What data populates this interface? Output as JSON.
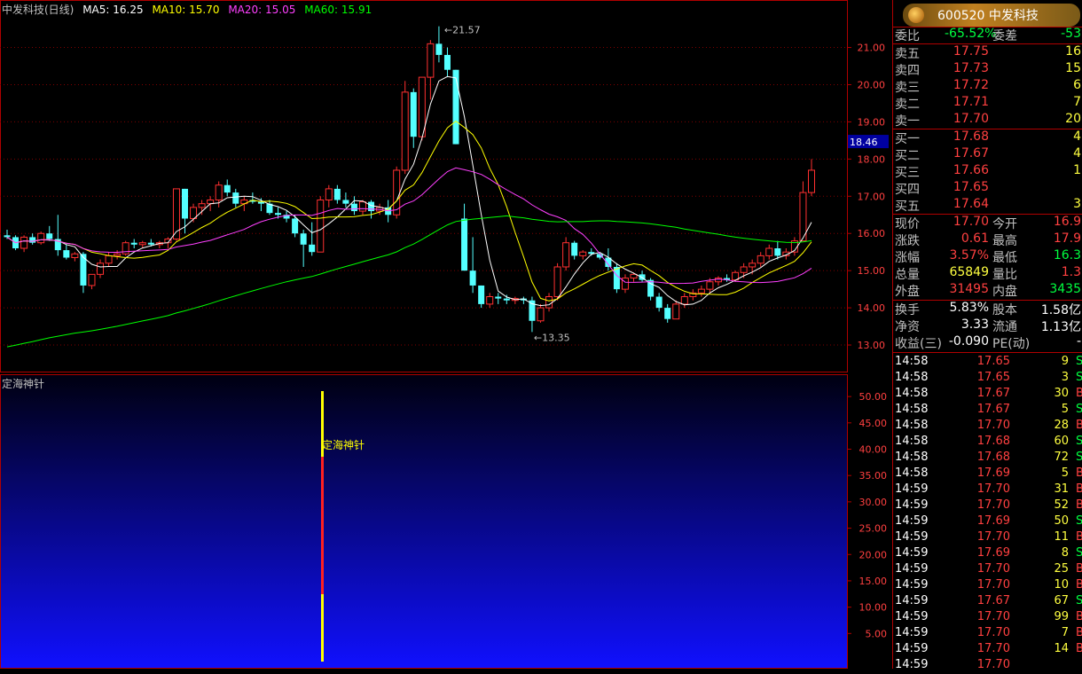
{
  "header": {
    "title": "中发科技(日线)",
    "ma5": "MA5: 16.25",
    "ma10": "MA10: 15.70",
    "ma20": "MA20: 15.05",
    "ma60": "MA60: 15.91",
    "colors": {
      "ma5": "#ffffff",
      "ma10": "#ffff00",
      "ma20": "#ff40ff",
      "ma60": "#00ff00"
    }
  },
  "indicator": {
    "title": "定海神针",
    "signal_label": "定海神针",
    "axis_ticks": [
      "50.00",
      "45.00",
      "40.00",
      "35.00",
      "30.00",
      "25.00",
      "20.00",
      "15.00",
      "10.00",
      "5.00"
    ]
  },
  "chart_data": {
    "type": "candlestick",
    "ylim": [
      12.5,
      21.8
    ],
    "y_ticks": [
      "21.00",
      "20.00",
      "19.00",
      "18.00",
      "17.00",
      "16.00",
      "15.00",
      "14.00",
      "13.00"
    ],
    "current_price_tag": "18.46",
    "high_label": "21.57",
    "low_label": "13.35",
    "colors": {
      "up": "#ff3030",
      "down": "#54ffff"
    },
    "candles": [
      [
        15.95,
        16.1,
        15.85,
        15.9
      ],
      [
        15.9,
        15.95,
        15.55,
        15.6
      ],
      [
        15.6,
        15.95,
        15.5,
        15.9
      ],
      [
        15.9,
        16.0,
        15.7,
        15.75
      ],
      [
        15.75,
        16.05,
        15.7,
        16.0
      ],
      [
        16.0,
        16.2,
        15.8,
        15.85
      ],
      [
        15.85,
        16.5,
        15.4,
        15.55
      ],
      [
        15.55,
        15.7,
        15.3,
        15.35
      ],
      [
        15.35,
        15.5,
        15.25,
        15.45
      ],
      [
        15.45,
        15.5,
        14.4,
        14.6
      ],
      [
        14.6,
        14.9,
        14.5,
        14.9
      ],
      [
        14.9,
        15.3,
        14.8,
        15.2
      ],
      [
        15.2,
        15.5,
        15.1,
        15.4
      ],
      [
        15.4,
        15.55,
        15.3,
        15.45
      ],
      [
        15.45,
        15.8,
        15.4,
        15.75
      ],
      [
        15.75,
        15.85,
        15.6,
        15.7
      ],
      [
        15.7,
        15.8,
        15.6,
        15.75
      ],
      [
        15.75,
        15.85,
        15.65,
        15.7
      ],
      [
        15.7,
        15.8,
        15.6,
        15.75
      ],
      [
        15.75,
        15.9,
        15.6,
        15.85
      ],
      [
        15.85,
        17.2,
        15.8,
        17.2
      ],
      [
        17.2,
        17.2,
        16.0,
        16.4
      ],
      [
        16.4,
        16.8,
        16.3,
        16.7
      ],
      [
        16.7,
        16.9,
        16.5,
        16.8
      ],
      [
        16.8,
        17.0,
        16.6,
        16.9
      ],
      [
        16.9,
        17.4,
        16.7,
        17.3
      ],
      [
        17.3,
        17.45,
        17.0,
        17.1
      ],
      [
        17.1,
        17.2,
        16.7,
        16.8
      ],
      [
        16.8,
        17.0,
        16.6,
        16.9
      ],
      [
        16.9,
        17.1,
        16.8,
        16.85
      ],
      [
        16.85,
        16.95,
        16.6,
        16.8
      ],
      [
        16.8,
        16.9,
        16.5,
        16.55
      ],
      [
        16.55,
        16.7,
        16.4,
        16.5
      ],
      [
        16.5,
        16.6,
        16.3,
        16.4
      ],
      [
        16.4,
        16.5,
        15.9,
        16.0
      ],
      [
        16.0,
        16.1,
        15.1,
        15.7
      ],
      [
        15.7,
        16.3,
        15.4,
        15.5
      ],
      [
        15.5,
        17.0,
        15.5,
        16.9
      ],
      [
        16.9,
        17.3,
        16.7,
        17.2
      ],
      [
        17.2,
        17.3,
        16.8,
        16.9
      ],
      [
        16.9,
        17.1,
        16.7,
        16.8
      ],
      [
        16.8,
        17.0,
        16.5,
        16.6
      ],
      [
        16.6,
        16.9,
        16.5,
        16.85
      ],
      [
        16.85,
        16.9,
        16.4,
        16.6
      ],
      [
        16.6,
        16.8,
        16.5,
        16.7
      ],
      [
        16.7,
        16.9,
        16.3,
        16.5
      ],
      [
        16.5,
        17.8,
        16.4,
        17.7
      ],
      [
        17.7,
        20.1,
        17.6,
        19.8
      ],
      [
        19.8,
        19.9,
        18.3,
        18.6
      ],
      [
        18.6,
        20.2,
        18.5,
        20.2
      ],
      [
        20.2,
        21.2,
        19.6,
        21.1
      ],
      [
        21.1,
        21.57,
        20.6,
        20.8
      ],
      [
        20.8,
        21.0,
        20.2,
        20.4
      ],
      [
        20.4,
        20.4,
        18.4,
        18.4
      ],
      [
        16.4,
        16.8,
        15.0,
        15.0
      ],
      [
        15.0,
        15.9,
        14.4,
        14.6
      ],
      [
        14.6,
        14.6,
        14.0,
        14.1
      ],
      [
        14.1,
        14.4,
        14.0,
        14.3
      ],
      [
        14.3,
        14.4,
        14.1,
        14.25
      ],
      [
        14.25,
        14.35,
        14.1,
        14.2
      ],
      [
        14.2,
        14.3,
        14.1,
        14.25
      ],
      [
        14.25,
        14.3,
        14.1,
        14.2
      ],
      [
        14.2,
        14.3,
        13.35,
        13.65
      ],
      [
        13.65,
        14.1,
        13.6,
        14.0
      ],
      [
        14.0,
        14.4,
        13.9,
        14.3
      ],
      [
        14.3,
        15.2,
        14.2,
        15.1
      ],
      [
        15.1,
        15.9,
        15.0,
        15.75
      ],
      [
        15.75,
        15.8,
        15.3,
        15.4
      ],
      [
        15.4,
        15.55,
        15.3,
        15.5
      ],
      [
        15.5,
        15.6,
        15.4,
        15.45
      ],
      [
        15.45,
        15.5,
        15.3,
        15.35
      ],
      [
        15.35,
        15.6,
        15.0,
        15.1
      ],
      [
        15.1,
        15.2,
        14.4,
        14.5
      ],
      [
        14.5,
        14.9,
        14.4,
        14.8
      ],
      [
        14.8,
        14.95,
        14.7,
        14.9
      ],
      [
        14.9,
        15.0,
        14.7,
        14.75
      ],
      [
        14.75,
        14.8,
        14.2,
        14.3
      ],
      [
        14.3,
        14.4,
        13.9,
        14.0
      ],
      [
        14.0,
        14.1,
        13.6,
        13.7
      ],
      [
        13.7,
        14.2,
        13.7,
        14.1
      ],
      [
        14.1,
        14.4,
        14.0,
        14.3
      ],
      [
        14.3,
        14.5,
        14.2,
        14.4
      ],
      [
        14.4,
        14.6,
        14.3,
        14.5
      ],
      [
        14.5,
        14.8,
        14.4,
        14.7
      ],
      [
        14.7,
        14.85,
        14.6,
        14.8
      ],
      [
        14.8,
        14.9,
        14.7,
        14.75
      ],
      [
        14.75,
        15.0,
        14.7,
        14.95
      ],
      [
        14.95,
        15.2,
        14.8,
        15.1
      ],
      [
        15.1,
        15.3,
        14.9,
        15.2
      ],
      [
        15.2,
        15.5,
        15.1,
        15.4
      ],
      [
        15.4,
        15.7,
        15.3,
        15.6
      ],
      [
        15.6,
        15.8,
        15.3,
        15.4
      ],
      [
        15.4,
        15.6,
        15.3,
        15.5
      ],
      [
        15.5,
        15.9,
        15.4,
        15.8
      ],
      [
        15.8,
        17.4,
        15.8,
        17.1
      ],
      [
        17.1,
        18.0,
        17.0,
        17.7
      ]
    ]
  },
  "quote": {
    "logo": "600520 中发科技",
    "wb": {
      "l1": "委比",
      "v1": "-65.52%",
      "l2": "委差",
      "v2": "-53"
    },
    "asks": [
      {
        "label": "卖五",
        "price": "17.75",
        "vol": "16"
      },
      {
        "label": "卖四",
        "price": "17.73",
        "vol": "15"
      },
      {
        "label": "卖三",
        "price": "17.72",
        "vol": "6"
      },
      {
        "label": "卖二",
        "price": "17.71",
        "vol": "7"
      },
      {
        "label": "卖一",
        "price": "17.70",
        "vol": "20"
      }
    ],
    "bids": [
      {
        "label": "买一",
        "price": "17.68",
        "vol": "4"
      },
      {
        "label": "买二",
        "price": "17.67",
        "vol": "4"
      },
      {
        "label": "买三",
        "price": "17.66",
        "vol": "1"
      },
      {
        "label": "买四",
        "price": "17.65",
        "vol": ""
      },
      {
        "label": "买五",
        "price": "17.64",
        "vol": "3"
      }
    ],
    "stats": [
      {
        "l1": "现价",
        "v1": "17.70",
        "l2": "今开",
        "v2": "16.9"
      },
      {
        "l1": "涨跌",
        "v1": "0.61",
        "l2": "最高",
        "v2": "17.9"
      },
      {
        "l1": "涨幅",
        "v1": "3.57%",
        "l2": "最低",
        "v2": "16.3"
      },
      {
        "l1": "总量",
        "v1": "65849",
        "l2": "量比",
        "v2": "1.3"
      },
      {
        "l1": "外盘",
        "v1": "31495",
        "l2": "内盘",
        "v2": "3435"
      }
    ],
    "fund": [
      {
        "l1": "换手",
        "v1": "5.83%",
        "l2": "股本",
        "v2": "1.58亿"
      },
      {
        "l1": "净资",
        "v1": "3.33",
        "l2": "流通",
        "v2": "1.13亿"
      },
      {
        "l1": "收益(三)",
        "v1": "-0.090",
        "l2": "PE(动)",
        "v2": "-"
      }
    ],
    "ticks": [
      {
        "time": "14:58",
        "price": "17.65",
        "vol": "9",
        "dir": "S"
      },
      {
        "time": "14:58",
        "price": "17.65",
        "vol": "3",
        "dir": "S"
      },
      {
        "time": "14:58",
        "price": "17.67",
        "vol": "30",
        "dir": "B"
      },
      {
        "time": "14:58",
        "price": "17.67",
        "vol": "5",
        "dir": "S"
      },
      {
        "time": "14:58",
        "price": "17.70",
        "vol": "28",
        "dir": "B"
      },
      {
        "time": "14:58",
        "price": "17.68",
        "vol": "60",
        "dir": "S"
      },
      {
        "time": "14:58",
        "price": "17.68",
        "vol": "72",
        "dir": "S"
      },
      {
        "time": "14:58",
        "price": "17.69",
        "vol": "5",
        "dir": "B"
      },
      {
        "time": "14:59",
        "price": "17.70",
        "vol": "31",
        "dir": "B"
      },
      {
        "time": "14:59",
        "price": "17.70",
        "vol": "52",
        "dir": "B"
      },
      {
        "time": "14:59",
        "price": "17.69",
        "vol": "50",
        "dir": "S"
      },
      {
        "time": "14:59",
        "price": "17.70",
        "vol": "11",
        "dir": "B"
      },
      {
        "time": "14:59",
        "price": "17.69",
        "vol": "8",
        "dir": "S"
      },
      {
        "time": "14:59",
        "price": "17.70",
        "vol": "25",
        "dir": "B"
      },
      {
        "time": "14:59",
        "price": "17.70",
        "vol": "10",
        "dir": "B"
      },
      {
        "time": "14:59",
        "price": "17.67",
        "vol": "67",
        "dir": "S"
      },
      {
        "time": "14:59",
        "price": "17.70",
        "vol": "99",
        "dir": "B"
      },
      {
        "time": "14:59",
        "price": "17.70",
        "vol": "7",
        "dir": "B"
      },
      {
        "time": "14:59",
        "price": "17.70",
        "vol": "14",
        "dir": "B"
      },
      {
        "time": "14:59",
        "price": "17.70",
        "vol": "",
        "dir": ""
      }
    ]
  }
}
